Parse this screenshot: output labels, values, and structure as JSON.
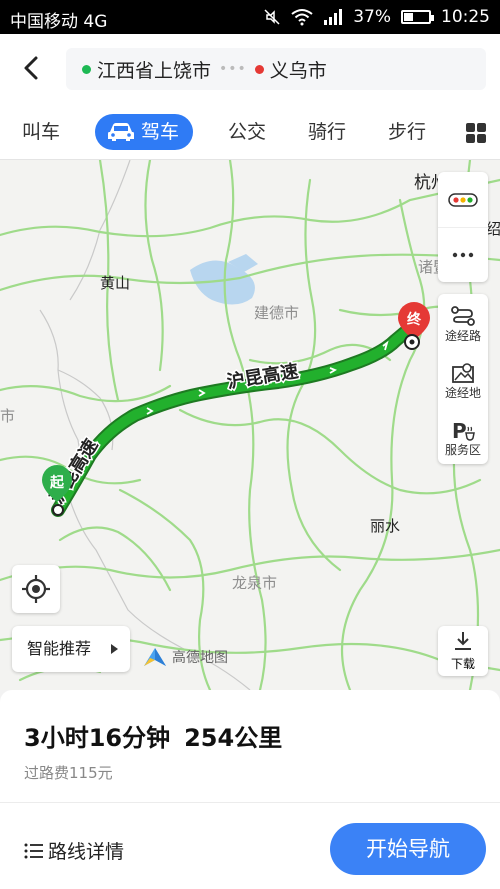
{
  "status_bar": {
    "carrier": "中国移动 4G",
    "battery": "37%",
    "battery_level": 0.37,
    "time": "10:25"
  },
  "route": {
    "origin": "江西省上饶市",
    "destination": "义乌市",
    "origin_color": "#1db954",
    "destination_color": "#e53935"
  },
  "modes": {
    "call_car": "叫车",
    "drive": "驾车",
    "transit": "公交",
    "ride": "骑行",
    "walk": "步行"
  },
  "map": {
    "cities": {
      "hangzhou": "杭州",
      "huangshan": "黄山",
      "jiande": "建德市",
      "zhuji": "诸暨",
      "shao": "绍",
      "lishui": "丽水",
      "longquan": "龙泉市",
      "shi_left": "市"
    },
    "highway": "沪昆高速",
    "start_marker": "起",
    "end_marker": "终",
    "route_color": "#22b02d"
  },
  "side_panel": {
    "waypoint_route": "途经路",
    "waypoint_place": "途经地",
    "service_area": "服务区",
    "download": "下载"
  },
  "smart_recommend": "智能推荐",
  "logo": "高德地图",
  "summary": {
    "duration": "3小时16分钟",
    "distance": "254公里",
    "toll": "过路费115元"
  },
  "route_details": "路线详情",
  "start_navigation": "开始导航"
}
